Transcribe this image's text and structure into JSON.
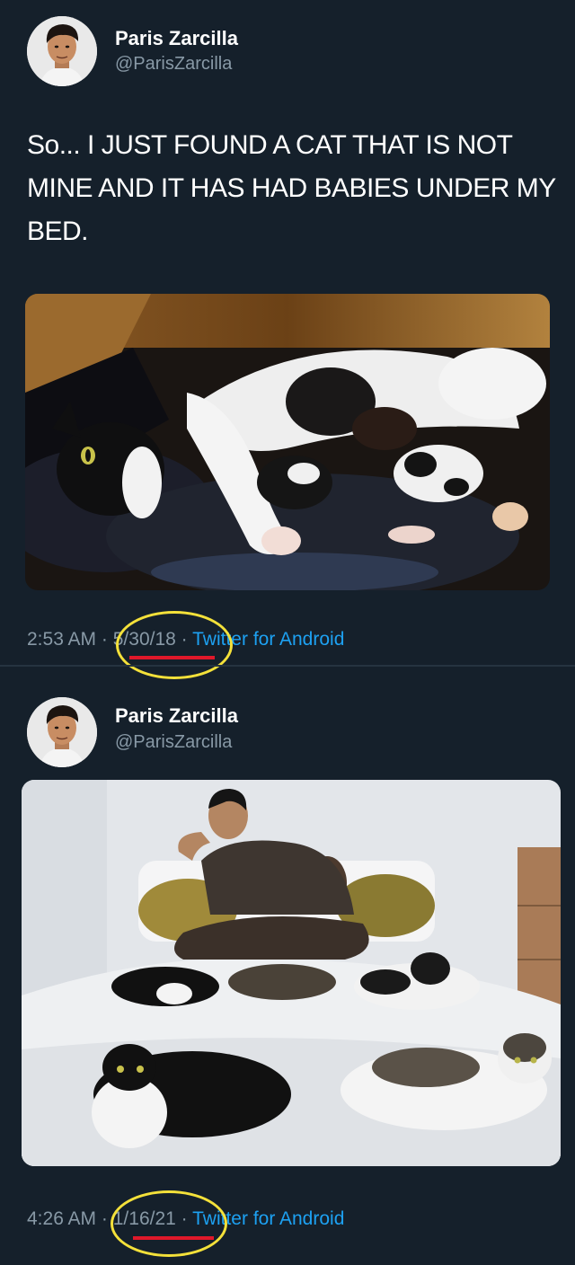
{
  "tweets": [
    {
      "name": "Paris Zarcilla",
      "handle": "@ParisZarcilla",
      "text": "So... I JUST FOUND A CAT THAT IS NOT MINE AND IT HAS HAD BABIES UNDER MY BED.",
      "time": "2:53 AM",
      "date": "5/30/18",
      "source": "Twitter for Android"
    },
    {
      "name": "Paris Zarcilla",
      "handle": "@ParisZarcilla",
      "time": "4:26 AM",
      "date": "1/16/21",
      "source": "Twitter for Android"
    }
  ],
  "colors": {
    "background": "#15202b",
    "secondary_text": "#8899a6",
    "link": "#1da1f2",
    "highlight_circle": "#f4e13a",
    "highlight_underline": "#e0182a"
  },
  "icons": {
    "avatar": "profile-photo"
  }
}
